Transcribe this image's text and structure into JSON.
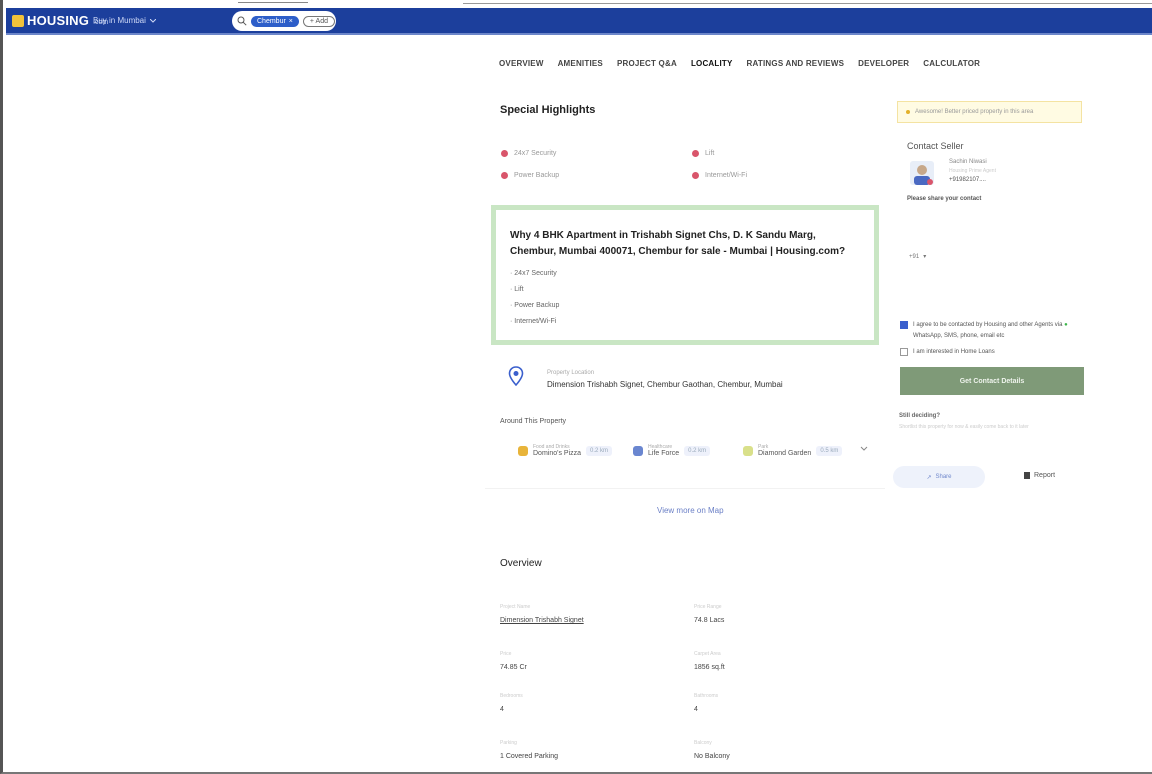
{
  "header": {
    "logo_text": "HOUSING",
    "logo_sub": ".com",
    "city_label": "Buy in Mumbai",
    "search_chip": "Chembur",
    "add_chip": "+ Add"
  },
  "tabs": [
    "OVERVIEW",
    "AMENITIES",
    "PROJECT Q&A",
    "LOCALITY",
    "RATINGS AND REVIEWS",
    "DEVELOPER",
    "CALCULATOR"
  ],
  "special_highlights": {
    "title": "Special Highlights",
    "items": [
      "24x7 Security",
      "Lift",
      "Power Backup",
      "Internet/Wi-Fi"
    ],
    "dot_color": "#d9556b"
  },
  "why": {
    "title": "Why 4 BHK Apartment in Trishabh Signet Chs, D. K Sandu Marg, Chembur, Mumbai 400071, Chembur for sale - Mumbai | Housing.com?",
    "list": [
      "24x7 Security",
      "Lift",
      "Power Backup",
      "Internet/Wi-Fi"
    ],
    "border_color": "#c9e6c4"
  },
  "location": {
    "label": "Property Location",
    "value": "Dimension Trishabh Signet, Chembur Gaothan, Chembur, Mumbai"
  },
  "around": {
    "title": "Around This Property",
    "items": [
      {
        "category": "Food and Drinks",
        "name": "Domino's Pizza",
        "distance": "0.2 km",
        "icon": "food-icon",
        "color": "#e8b43a"
      },
      {
        "category": "Healthcare",
        "name": "Life Force",
        "distance": "0.2 km",
        "icon": "health-icon",
        "color": "#6a86d0"
      },
      {
        "category": "Park",
        "name": "Diamond Garden",
        "distance": "0.5 km",
        "icon": "park-icon",
        "color": "#d9e08a"
      }
    ]
  },
  "view_map": "View more on Map",
  "sidebar": {
    "awesome_note": "Awesome! Better priced property in this area",
    "contact_title": "Contact Seller",
    "seller_name": "Sachin Niwasi",
    "seller_sub": "Housing Prime Agent",
    "seller_phone": "+91982107....",
    "share_prompt": "Please share your contact",
    "country_code": "+91",
    "agree_text": "I agree to be contacted by Housing and other Agents via",
    "agree_text_2": "WhatsApp, SMS, phone, email etc",
    "loan_text": "I am interested in Home Loans",
    "cta": "Get Contact Details",
    "still_title": "Still deciding?",
    "still_sub": "Shortlist this property for now & easily come back to it later",
    "share": "Share",
    "report": "Report",
    "accent": "#7f9a78"
  },
  "overview": {
    "title": "Overview",
    "rows": [
      {
        "label_l": "Project Name",
        "value_l": "Dimension Trishabh Signet",
        "label_r": "Price Range",
        "value_r": "74.8 Lacs"
      },
      {
        "label_l": "Price",
        "value_l": "74.85 Cr",
        "label_r": "Carpet Area",
        "value_r": "1856 sq.ft"
      },
      {
        "label_l": "Bedrooms",
        "value_l": "4",
        "label_r": "Bathrooms",
        "value_r": "4"
      },
      {
        "label_l": "Parking",
        "value_l": "1 Covered Parking",
        "label_r": "Balcony",
        "value_r": "No Balcony"
      }
    ]
  }
}
